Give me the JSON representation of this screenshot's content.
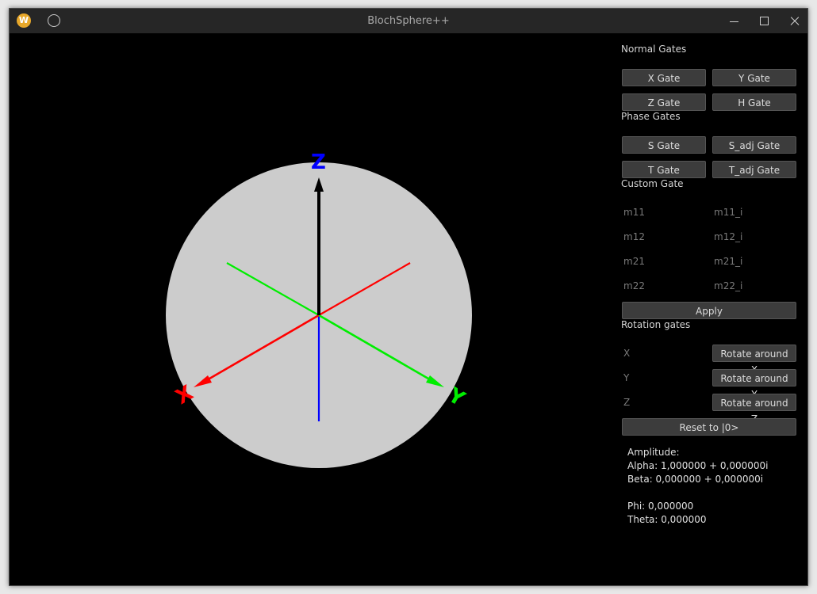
{
  "window": {
    "title": "BlochSphere++",
    "app_icon_letter": "W"
  },
  "sphere": {
    "axis_labels": {
      "x": "X",
      "y": "Y",
      "z": "Z"
    },
    "colors": {
      "sphere": "#cccccc",
      "x_axis": "#ff0000",
      "y_axis": "#00ee00",
      "z_axis": "#0000ff",
      "state_vector": "#000000"
    }
  },
  "panel": {
    "normal_gates_label": "Normal Gates",
    "x_gate": "X Gate",
    "y_gate": "Y Gate",
    "z_gate": "Z Gate",
    "h_gate": "H Gate",
    "phase_gates_label": "Phase Gates",
    "s_gate": "S Gate",
    "s_adj_gate": "S_adj Gate",
    "t_gate": "T Gate",
    "t_adj_gate": "T_adj Gate",
    "custom_gate_label": "Custom Gate",
    "m11": "m11",
    "m11_i": "m11_i",
    "m12": "m12",
    "m12_i": "m12_i",
    "m21": "m21",
    "m21_i": "m21_i",
    "m22": "m22",
    "m22_i": "m22_i",
    "apply": "Apply",
    "rotation_gates_label": "Rotation gates",
    "rx_placeholder": "X",
    "ry_placeholder": "Y",
    "rz_placeholder": "Z",
    "rotate_x": "Rotate around X",
    "rotate_y": "Rotate around Y",
    "rotate_z": "Rotate around Z",
    "reset": "Reset to |0>",
    "amplitude_label": "Amplitude:",
    "alpha": "Alpha: 1,000000 + 0,000000i",
    "beta": "Beta: 0,000000 + 0,000000i",
    "phi": "Phi: 0,000000",
    "theta": "Theta: 0,000000"
  }
}
